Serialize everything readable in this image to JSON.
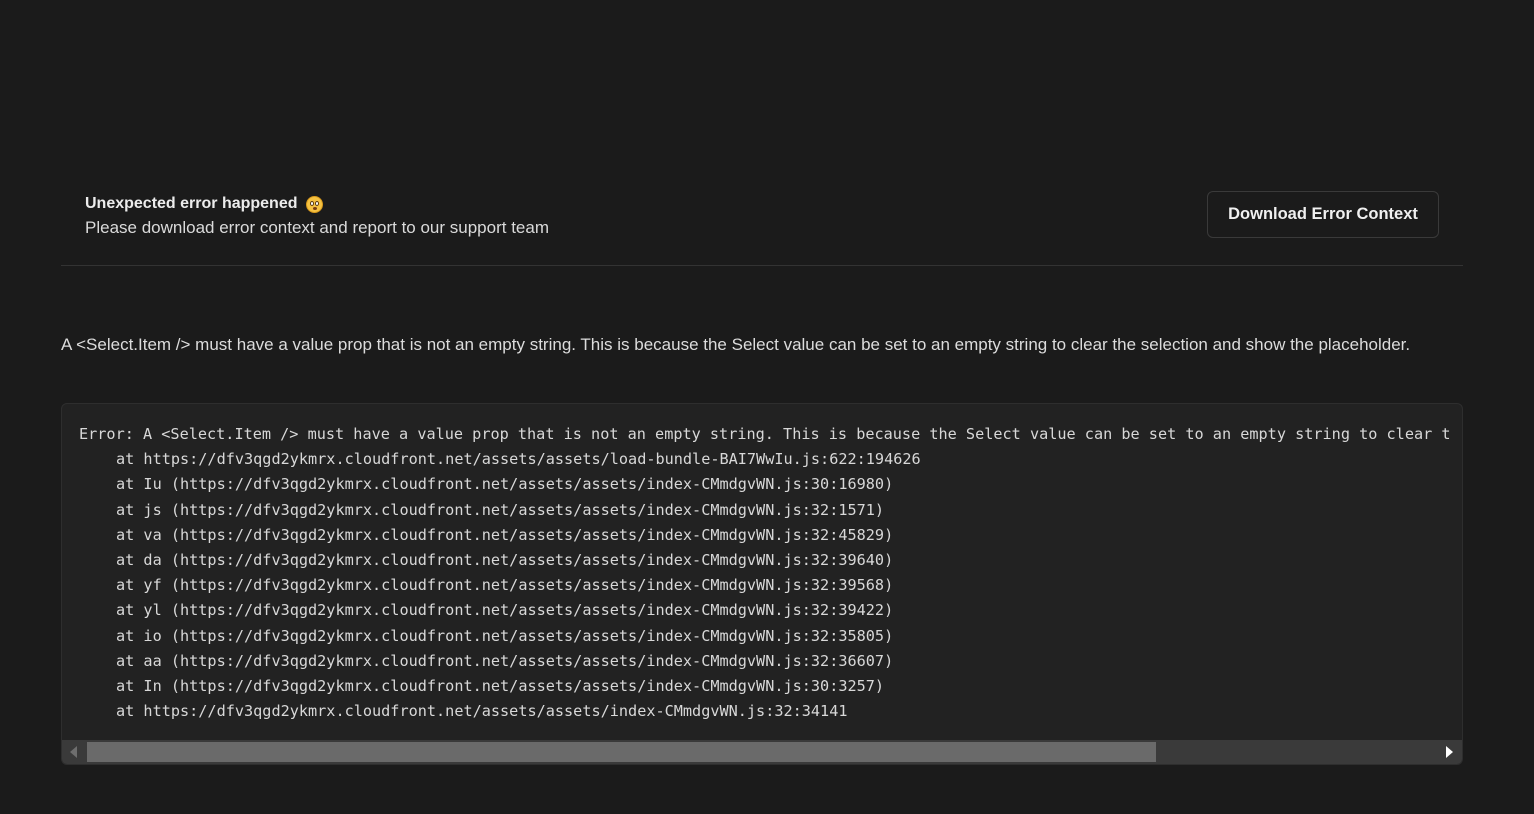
{
  "header": {
    "title": "Unexpected error happened",
    "title_emoji": "flushed-face-icon",
    "subtitle": "Please download error context and report to our support team",
    "download_button_label": "Download Error Context"
  },
  "error": {
    "message": "A <Select.Item /> must have a value prop that is not an empty string. This is because the Select value can be set to an empty string to clear the selection and show the placeholder.",
    "stack_header": "Error: A <Select.Item /> must have a value prop that is not an empty string. This is because the Select value can be set to an empty string to clear t",
    "stack_frames": [
      "at https://dfv3qgd2ykmrx.cloudfront.net/assets/assets/load-bundle-BAI7WwIu.js:622:194626",
      "at Iu (https://dfv3qgd2ykmrx.cloudfront.net/assets/assets/index-CMmdgvWN.js:30:16980)",
      "at js (https://dfv3qgd2ykmrx.cloudfront.net/assets/assets/index-CMmdgvWN.js:32:1571)",
      "at va (https://dfv3qgd2ykmrx.cloudfront.net/assets/assets/index-CMmdgvWN.js:32:45829)",
      "at da (https://dfv3qgd2ykmrx.cloudfront.net/assets/assets/index-CMmdgvWN.js:32:39640)",
      "at yf (https://dfv3qgd2ykmrx.cloudfront.net/assets/assets/index-CMmdgvWN.js:32:39568)",
      "at yl (https://dfv3qgd2ykmrx.cloudfront.net/assets/assets/index-CMmdgvWN.js:32:39422)",
      "at io (https://dfv3qgd2ykmrx.cloudfront.net/assets/assets/index-CMmdgvWN.js:32:35805)",
      "at aa (https://dfv3qgd2ykmrx.cloudfront.net/assets/assets/index-CMmdgvWN.js:32:36607)",
      "at In (https://dfv3qgd2ykmrx.cloudfront.net/assets/assets/index-CMmdgvWN.js:30:3257)",
      "at https://dfv3qgd2ykmrx.cloudfront.net/assets/assets/index-CMmdgvWN.js:32:34141"
    ]
  },
  "colors": {
    "background": "#1b1b1b",
    "code_background": "#222222",
    "scrollbar_track": "#3a3a3a",
    "scrollbar_thumb": "#6a6a6a"
  }
}
